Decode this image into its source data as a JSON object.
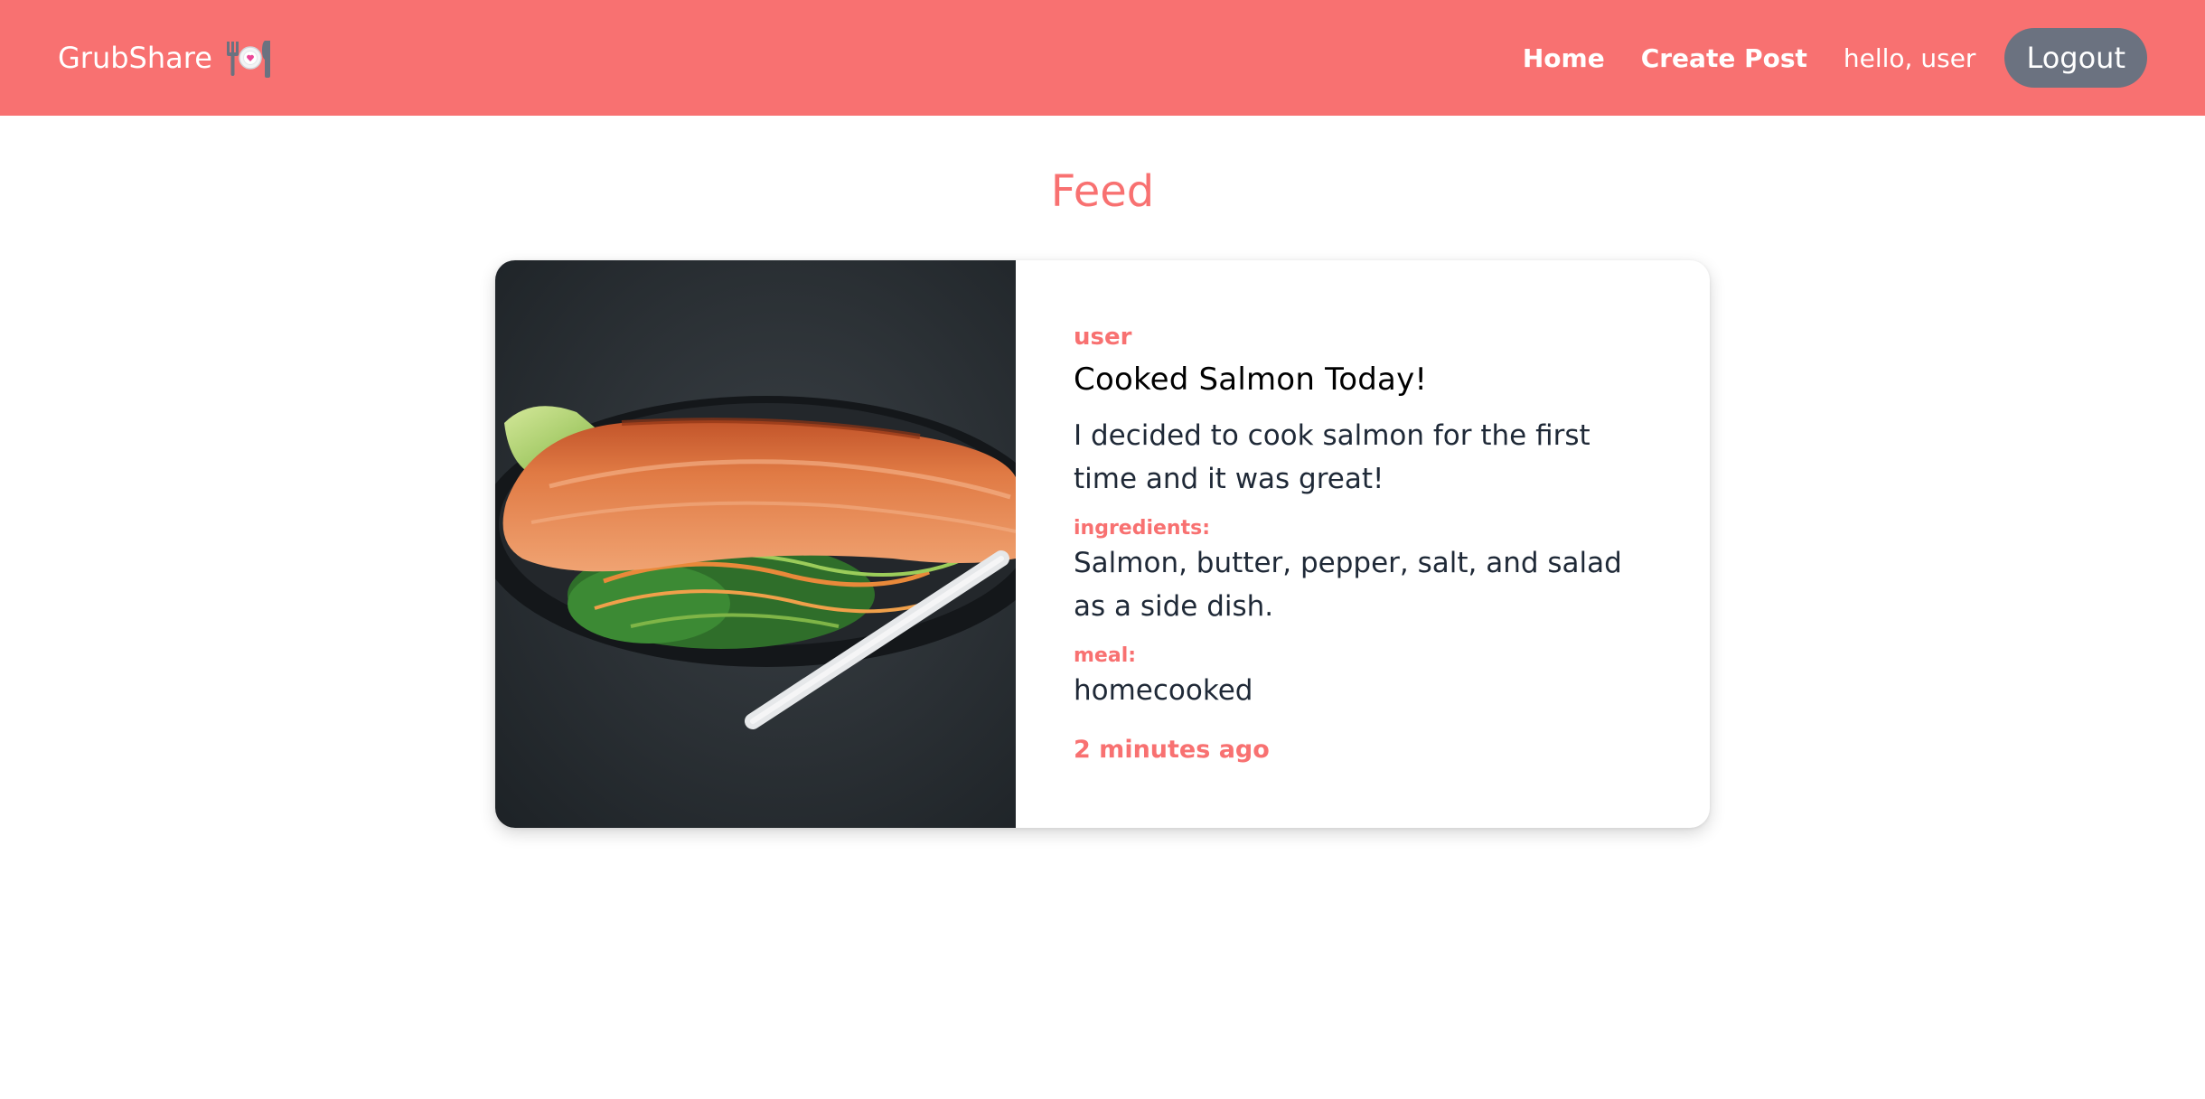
{
  "navbar": {
    "brand": "GrubShare",
    "brand_icon": "plate-fork-knife-icon",
    "links": [
      "Home",
      "Create Post"
    ],
    "greeting": "hello, user",
    "logout_label": "Logout",
    "colors": {
      "bar": "#f87171",
      "logout": "#6b7280"
    }
  },
  "feed": {
    "title": "Feed",
    "posts": [
      {
        "author": "user",
        "title": "Cooked Salmon Today!",
        "text": "I decided to cook salmon for the first time and it was great!",
        "ingredients_label": "ingredients:",
        "ingredients": "Salmon, butter, pepper, salt, and salad as a side dish.",
        "meal_label": "meal:",
        "meal": "homecooked",
        "time": "2 minutes ago"
      }
    ]
  }
}
